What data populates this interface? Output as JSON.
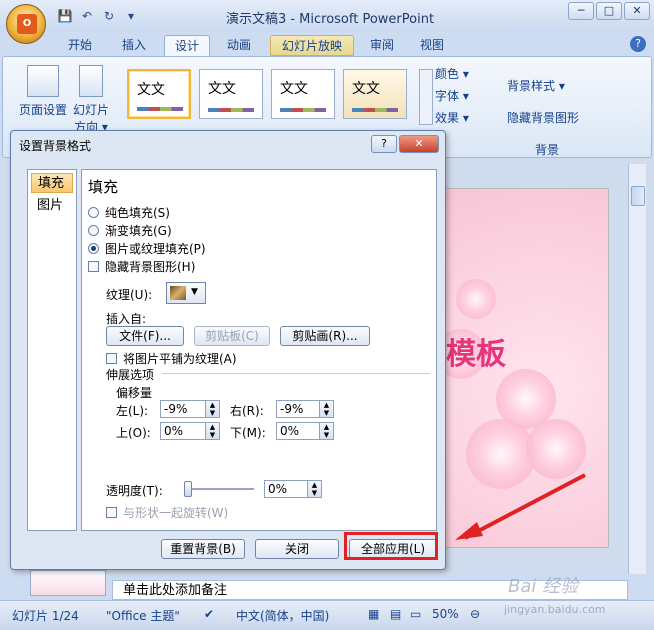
{
  "app": {
    "title": "演示文稿3 - Microsoft PowerPoint"
  },
  "qat": {
    "save": "💾",
    "undo": "↶",
    "redo": "↻",
    "more": "▾"
  },
  "window_controls": {
    "minimize": "─",
    "maximize": "□",
    "close": "✕"
  },
  "tabs": [
    {
      "label": "开始"
    },
    {
      "label": "插入"
    },
    {
      "label": "设计"
    },
    {
      "label": "动画"
    },
    {
      "label": "幻灯片放映"
    },
    {
      "label": "审阅"
    },
    {
      "label": "视图"
    }
  ],
  "ribbon": {
    "page_setup": "页面设置",
    "orientation": "幻灯片\n方向",
    "orientation_l1": "幻灯片",
    "orientation_l2": "方向 ▾",
    "themes": [
      {
        "label": "文文"
      },
      {
        "label": "文文"
      },
      {
        "label": "文文"
      },
      {
        "label": "文文"
      }
    ],
    "colors": "颜色 ▾",
    "fonts": "字体 ▾",
    "effects": "效果 ▾",
    "bg_styles": "背景样式 ▾",
    "hide_bg": "隐藏背景图形",
    "bg_group": "背景"
  },
  "dialog": {
    "title": "设置背景格式",
    "help": "?",
    "close": "✕",
    "nav": {
      "fill": "填充",
      "picture": "图片"
    },
    "heading": "填充",
    "options": {
      "solid": "纯色填充(S)",
      "gradient": "渐变填充(G)",
      "picture": "图片或纹理填充(P)",
      "hide": "隐藏背景图形(H)"
    },
    "texture_label": "纹理(U):",
    "insert_from": "插入自:",
    "file_btn": "文件(F)...",
    "clipboard_btn": "剪贴板(C)",
    "clipart_btn": "剪贴画(R)...",
    "tile": "将图片平铺为纹理(A)",
    "stretch": "伸展选项",
    "offset": "偏移量",
    "left_lbl": "左(L):",
    "left_val": "-9%",
    "right_lbl": "右(R):",
    "right_val": "-9%",
    "top_lbl": "上(O):",
    "top_val": "0%",
    "bottom_lbl": "下(M):",
    "bottom_val": "0%",
    "transparency_lbl": "透明度(T):",
    "transparency_val": "0%",
    "rotate": "与形状一起旋转(W)",
    "reset": "重置背景(B)",
    "close_btn": "关闭",
    "apply_all": "全部应用(L)"
  },
  "slide": {
    "title": "模板"
  },
  "notes": {
    "placeholder": "单击此处添加备注"
  },
  "status": {
    "slide": "幻灯片 1/24",
    "theme": "\"Office 主题\"",
    "lang": "中文(简体，中国)",
    "zoom": "50%"
  },
  "watermark": {
    "main": "Bai  经验",
    "sub": "jingyan.baidu.com"
  },
  "colors": {
    "accent": "#e5357b",
    "highlight": "#e02222"
  }
}
